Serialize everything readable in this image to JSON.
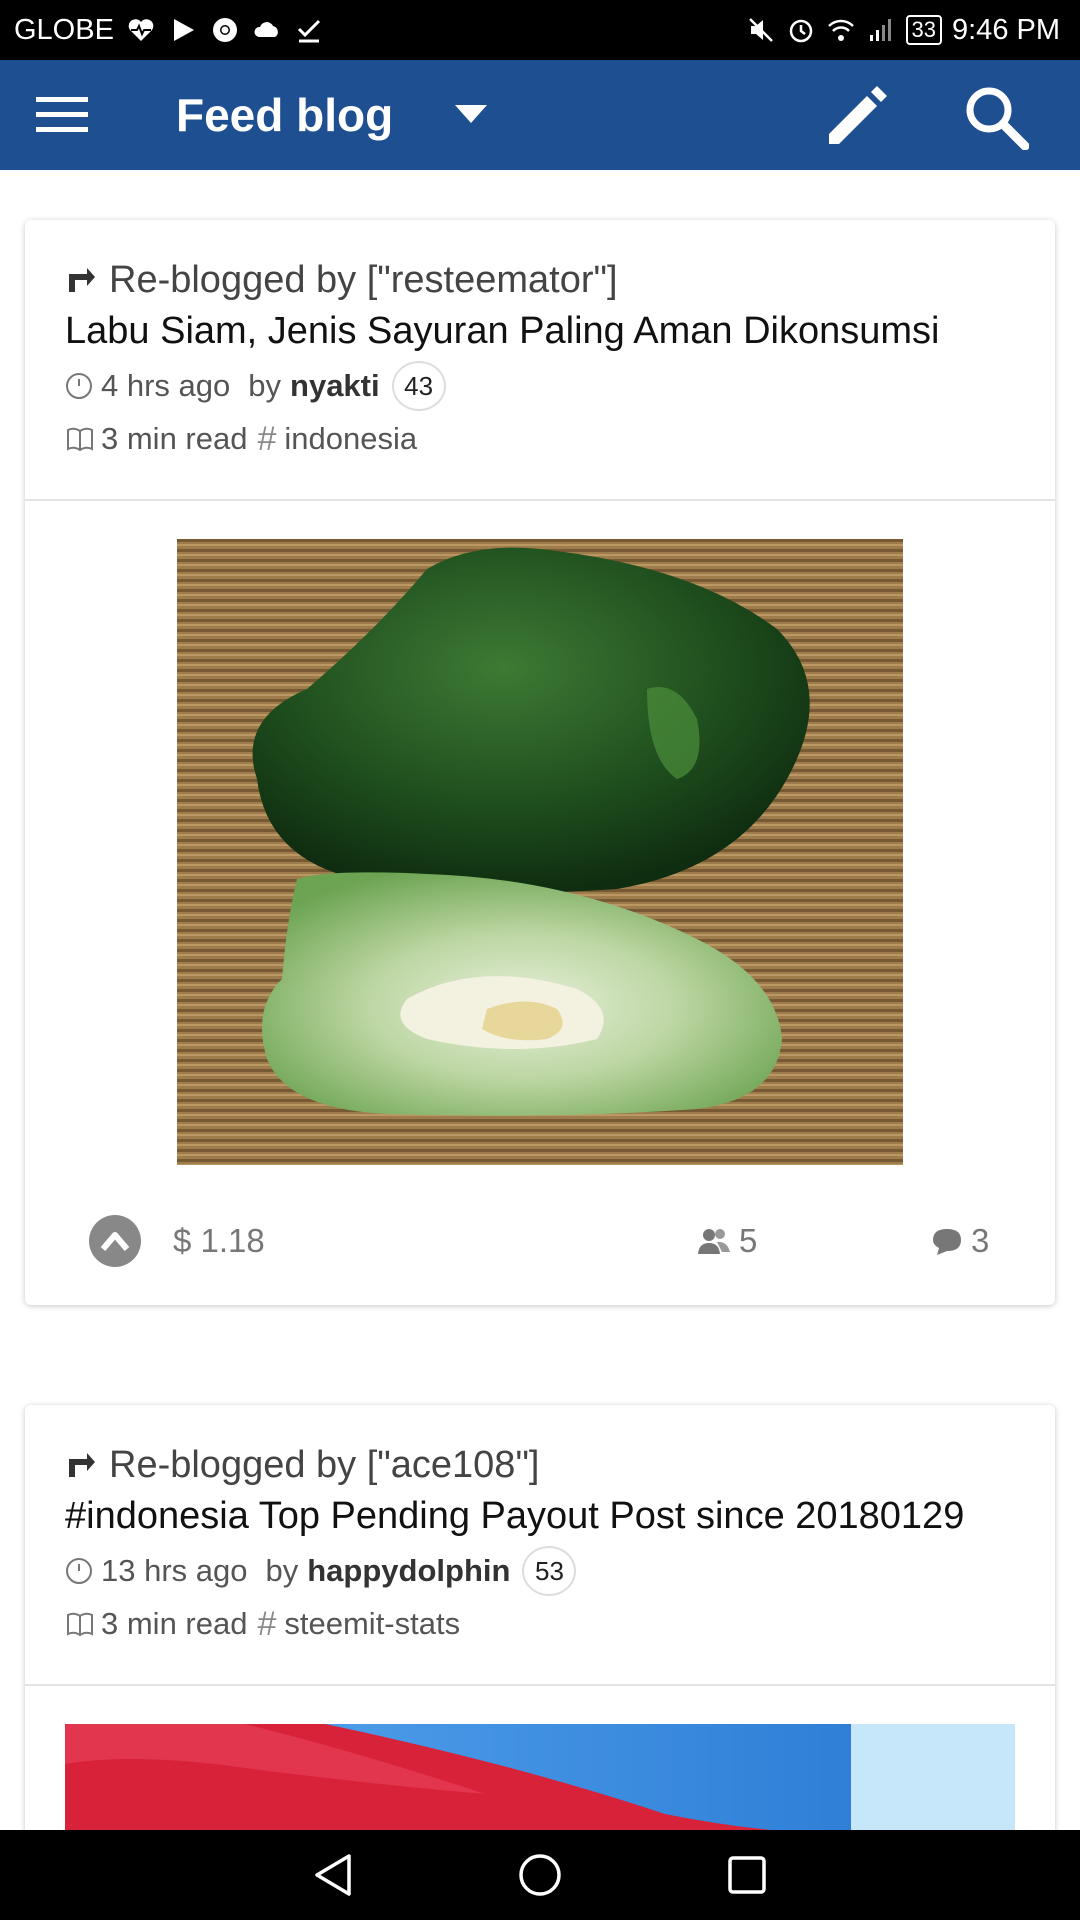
{
  "status_bar": {
    "carrier": "GLOBE",
    "battery": "33",
    "time": "9:46 PM",
    "icons_left": [
      "heart-monitor-icon",
      "play-icon",
      "chrome-icon",
      "cloud-icon",
      "check-icon"
    ],
    "icons_right": [
      "mute-icon",
      "alarm-icon",
      "wifi-icon",
      "signal-icon",
      "battery-icon"
    ]
  },
  "app_bar": {
    "title": "Feed blog",
    "background": "#1e4f91",
    "icons": [
      "menu-icon",
      "dropdown-arrow-icon",
      "pencil-icon",
      "search-icon"
    ]
  },
  "feed": {
    "posts": [
      {
        "reblog_text": "Re-blogged by [\"resteemator\"]",
        "title": "Labu Siam, Jenis Sayuran Paling Aman Dikonsumsi",
        "time": "4 hrs ago",
        "by_label": "by",
        "author": "nyakti",
        "reputation": "43",
        "read_time": "3 min read",
        "tag": "indonesia",
        "payout": "1.18",
        "currency_symbol": "$",
        "voters": "5",
        "comments": "3"
      },
      {
        "reblog_text": "Re-blogged by [\"ace108\"]",
        "title": "#indonesia Top Pending Payout Post since 20180129",
        "time": "13 hrs ago",
        "by_label": "by",
        "author": "happydolphin",
        "reputation": "53",
        "read_time": "3 min read",
        "tag": "steemit-stats"
      }
    ]
  },
  "nav_bar": {
    "icons": [
      "back-icon",
      "home-icon",
      "recents-icon"
    ]
  }
}
